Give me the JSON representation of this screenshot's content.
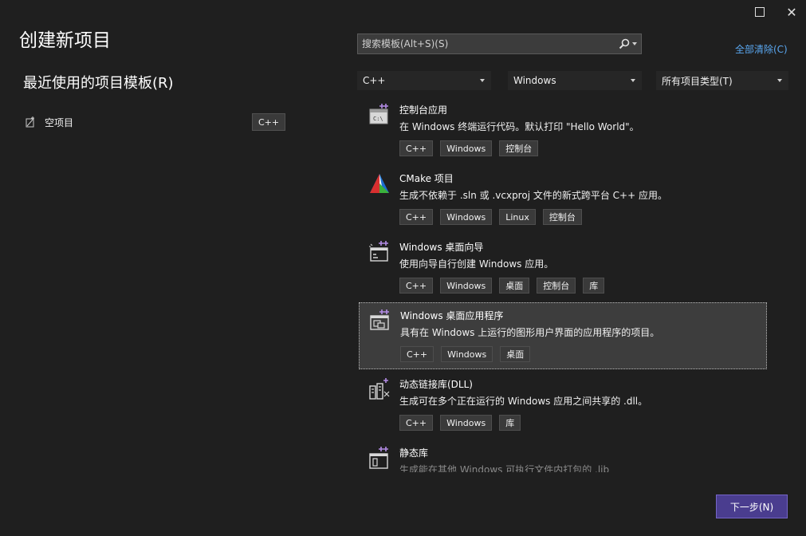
{
  "window": {
    "maximize_label": "maximize",
    "close_label": "close"
  },
  "page_title": "创建新项目",
  "recent": {
    "title": "最近使用的项目模板(R)",
    "items": [
      {
        "label": "空项目",
        "tag": "C++"
      }
    ]
  },
  "search": {
    "placeholder": "搜索模板(Alt+S)(S)",
    "value": ""
  },
  "clear_all": "全部清除(C)",
  "filters": {
    "language": "C++",
    "platform": "Windows",
    "project_type": "所有项目类型(T)"
  },
  "templates": [
    {
      "name": "控制台应用",
      "desc": "在 Windows 终端运行代码。默认打印 \"Hello World\"。",
      "tags": [
        "C++",
        "Windows",
        "控制台"
      ],
      "icon": "console-app-icon"
    },
    {
      "name": "CMake 项目",
      "desc": "生成不依赖于 .sln 或 .vcxproj 文件的新式跨平台 C++ 应用。",
      "tags": [
        "C++",
        "Windows",
        "Linux",
        "控制台"
      ],
      "icon": "cmake-icon"
    },
    {
      "name": "Windows 桌面向导",
      "desc": "使用向导自行创建 Windows 应用。",
      "tags": [
        "C++",
        "Windows",
        "桌面",
        "控制台",
        "库"
      ],
      "icon": "desktop-wizard-icon"
    },
    {
      "name": "Windows 桌面应用程序",
      "desc": "具有在 Windows 上运行的图形用户界面的应用程序的项目。",
      "tags": [
        "C++",
        "Windows",
        "桌面"
      ],
      "icon": "desktop-app-icon",
      "selected": true
    },
    {
      "name": "动态链接库(DLL)",
      "desc": "生成可在多个正在运行的 Windows 应用之间共享的 .dll。",
      "tags": [
        "C++",
        "Windows",
        "库"
      ],
      "icon": "dll-icon"
    },
    {
      "name": "静态库",
      "desc": "生成能在其他 Windows 可执行文件内打包的 .lib",
      "tags": [],
      "icon": "static-lib-icon"
    }
  ],
  "next_button": "下一步(N)",
  "colors": {
    "accent": "#4a3d8f",
    "link": "#5aa7f0",
    "background": "#1f1f1f"
  }
}
